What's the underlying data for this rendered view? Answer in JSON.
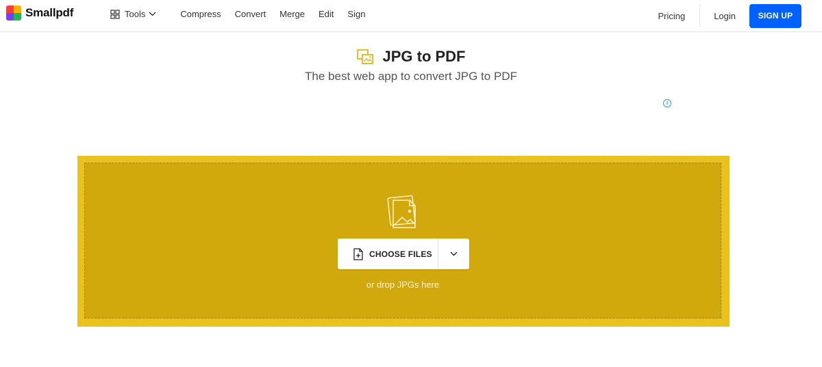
{
  "brand": {
    "name": "Smallpdf"
  },
  "nav": {
    "tools_label": "Tools",
    "links": [
      "Compress",
      "Convert",
      "Merge",
      "Edit",
      "Sign"
    ]
  },
  "right_nav": {
    "pricing": "Pricing",
    "login": "Login",
    "signup": "SIGN UP"
  },
  "hero": {
    "title": "JPG to PDF",
    "subtitle": "The best web app to convert JPG to PDF",
    "info_glyph": "i"
  },
  "dropzone": {
    "choose_label": "CHOOSE FILES",
    "drop_text": "or drop JPGs here"
  },
  "colors": {
    "accent_blue": "#0061fe",
    "dropzone_outer": "#e9c21d",
    "dropzone_inner": "#d2a90d",
    "title_icon": "#e7b417"
  },
  "icons": [
    "grid-icon",
    "chevron-down-icon",
    "jpg-icon",
    "info-icon",
    "images-icon",
    "file-add-icon"
  ]
}
